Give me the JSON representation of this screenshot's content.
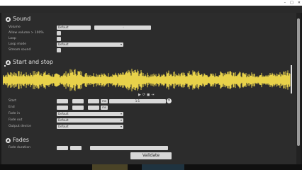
{
  "app": {
    "title": "",
    "win_min": "–",
    "win_max": "□",
    "win_close": "✕"
  },
  "sections": {
    "sound": {
      "title": "Sound",
      "labels": {
        "volume": "Volume",
        "allow_volume_above": "Allow volume > 100%",
        "loop": "Loop",
        "loop_mode": "Loop mode",
        "stream_sound": "Stream sound"
      },
      "volume_value": "Default",
      "volume_slider": "",
      "loop_mode_value": "Default"
    },
    "start_stop": {
      "title": "Start and stop",
      "labels": {
        "start": "Start",
        "end": "End",
        "fade_in": "Fade in",
        "fade_out": "Fade out",
        "output_device": "Output device"
      },
      "fade_in_value": "Default",
      "fade_out_value": "Default",
      "output_device_value": "Default",
      "time_value": "1:1",
      "time_unit": "ms"
    },
    "fades": {
      "title": "Fades",
      "labels": {
        "fade_duration": "Fade duration"
      }
    }
  },
  "validate_label": "Validate",
  "colors": {
    "waveform": "#e8d24a",
    "background": "#2c2c2c"
  }
}
